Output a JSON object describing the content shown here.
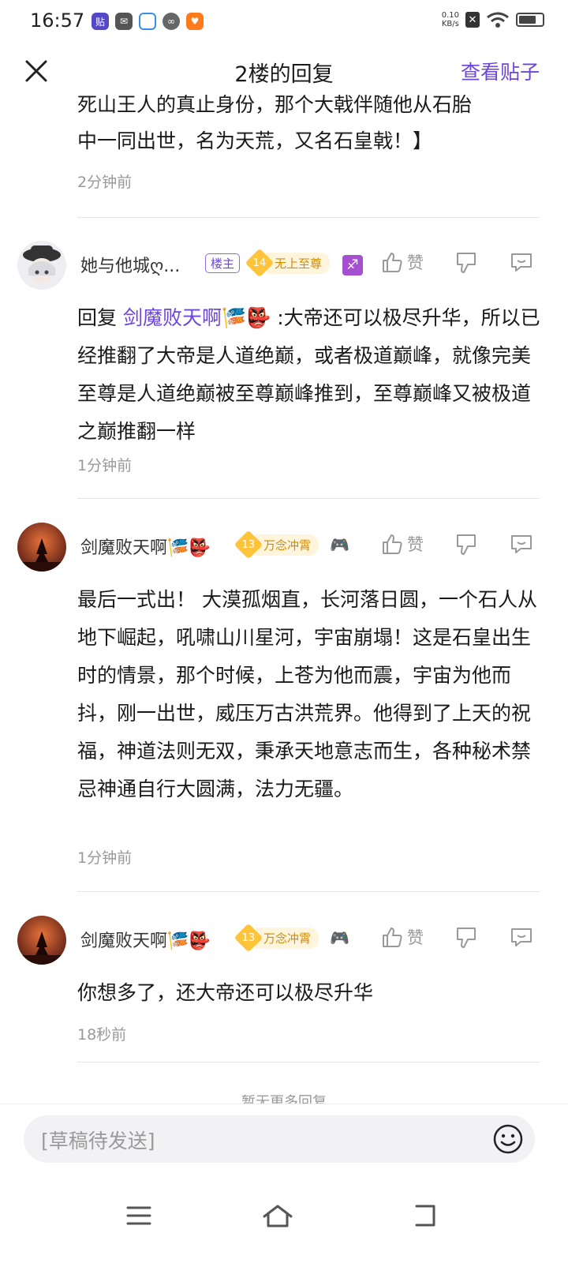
{
  "status_bar": {
    "time": "16:57",
    "net_speed_value": "0.10",
    "net_speed_unit": "KB/s",
    "battery_level_pct": 75,
    "icons": [
      "baidu-tieba-icon",
      "mail-icon",
      "browser-icon",
      "link-icon",
      "game-icon",
      "close-icon",
      "wifi-icon",
      "battery-icon"
    ]
  },
  "header": {
    "title": "2楼的回复",
    "view_post": "查看贴子"
  },
  "partial_comment": {
    "line1": "死山王人的真止身份，那个大戟伴随他从石胎",
    "line2": "中一同出世，名为天荒，又名石皇戟！】",
    "time": "2分钟前"
  },
  "comments": [
    {
      "username": "她与他城ღ...",
      "owner_badge": "楼主",
      "level": "14",
      "level_title": "无上至尊",
      "zodiac": "♐",
      "like_label": "赞",
      "reply_prefix": "回复",
      "reply_to": "剑魔败天啊",
      "reply_deco": "🎏👺",
      "text": ":大帝还可以极尽升华，所以已经推翻了大帝是人道绝巅，或者极道巅峰，就像完美至尊是人道绝巅被至尊巅峰推到，至尊巅峰又被极道之巅推翻一样",
      "time": "1分钟前"
    },
    {
      "username": "剑魔败天啊",
      "name_deco": "🎏👺",
      "level": "13",
      "level_title": "万念冲霄",
      "extra_badge": "🎮",
      "like_label": "赞",
      "text": "最后一式出！ 大漠孤烟直，长河落日圆，一个石人从地下崛起，吼啸山川星河，宇宙崩塌！这是石皇出生时的情景，那个时候，上苍为他而震，宇宙为他而抖，刚一出世，威压万古洪荒界。他得到了上天的祝福，神道法则无双，秉承天地意志而生，各种秘术禁忌神通自行大圆满，法力无疆。",
      "time": "1分钟前"
    },
    {
      "username": "剑魔败天啊",
      "name_deco": "🎏👺",
      "level": "13",
      "level_title": "万念冲霄",
      "extra_badge": "🎮",
      "like_label": "赞",
      "text": "你想多了，还大帝还可以极尽升华",
      "time": "18秒前"
    }
  ],
  "no_more": "暂无更多回复",
  "input": {
    "placeholder": "[草稿待发送]"
  },
  "colors": {
    "accent": "#6b46d8",
    "meta_gray": "#999999",
    "level_gold": "#ffc43a"
  }
}
